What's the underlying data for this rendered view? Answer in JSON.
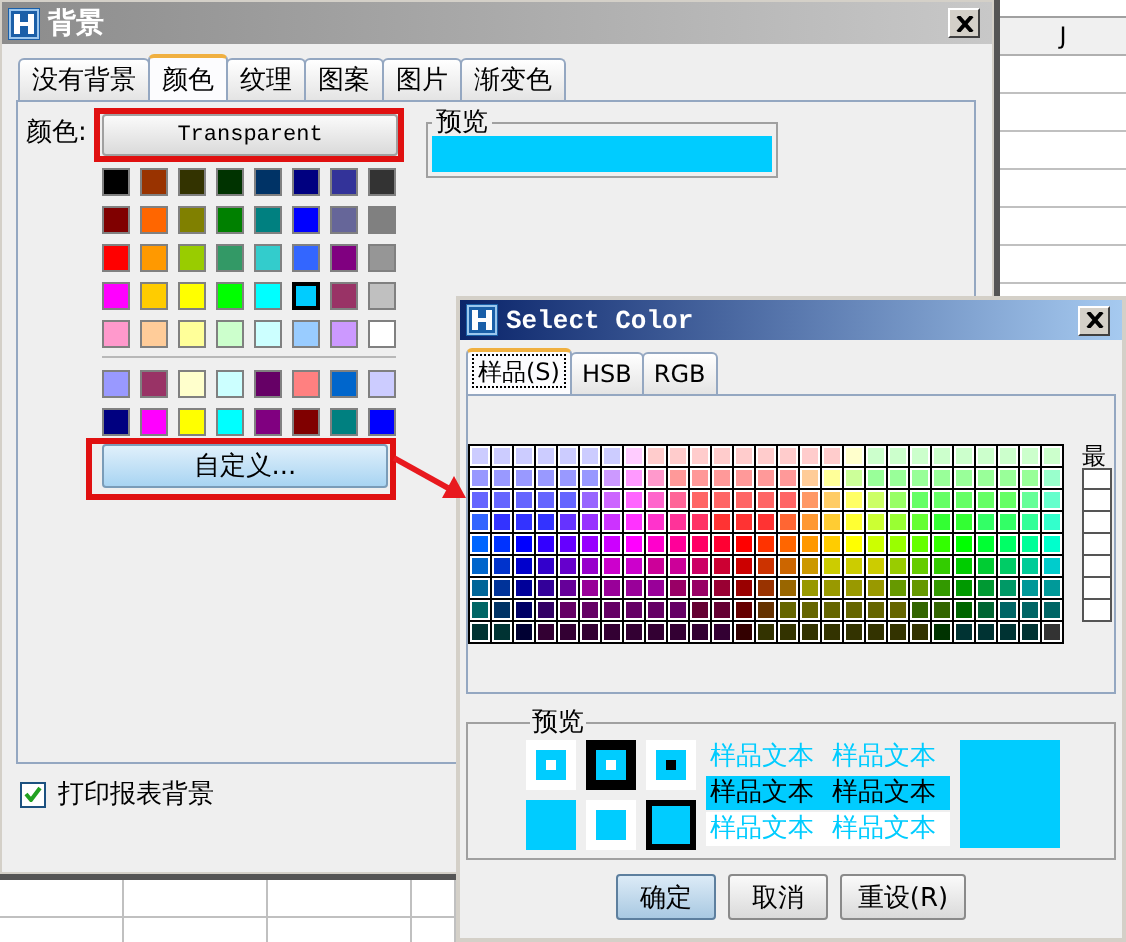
{
  "spreadsheet": {
    "column_header": "J"
  },
  "background_dialog": {
    "title": "背景",
    "tabs": [
      {
        "label": "没有背景",
        "selected": false
      },
      {
        "label": "颜色",
        "selected": true
      },
      {
        "label": "纹理",
        "selected": false
      },
      {
        "label": "图案",
        "selected": false
      },
      {
        "label": "图片",
        "selected": false
      },
      {
        "label": "渐变色",
        "selected": false
      }
    ],
    "color_label": "颜色:",
    "transparent_button": "Transparent",
    "preview_label": "预览",
    "standard_swatches": [
      {
        "swatches": [
          {
            "color": "#000000",
            "selected": false
          },
          {
            "color": "#993300",
            "selected": false
          },
          {
            "color": "#333300",
            "selected": false
          },
          {
            "color": "#003300",
            "selected": false
          },
          {
            "color": "#003366",
            "selected": false
          },
          {
            "color": "#000080",
            "selected": false
          },
          {
            "color": "#333399",
            "selected": false
          },
          {
            "color": "#333333",
            "selected": false
          }
        ]
      },
      {
        "swatches": [
          {
            "color": "#800000",
            "selected": false
          },
          {
            "color": "#ff6600",
            "selected": false
          },
          {
            "color": "#808000",
            "selected": false
          },
          {
            "color": "#008000",
            "selected": false
          },
          {
            "color": "#008080",
            "selected": false
          },
          {
            "color": "#0000ff",
            "selected": false
          },
          {
            "color": "#666699",
            "selected": false
          },
          {
            "color": "#808080",
            "selected": false
          }
        ]
      },
      {
        "swatches": [
          {
            "color": "#ff0000",
            "selected": false
          },
          {
            "color": "#ff9900",
            "selected": false
          },
          {
            "color": "#99cc00",
            "selected": false
          },
          {
            "color": "#339966",
            "selected": false
          },
          {
            "color": "#33cccc",
            "selected": false
          },
          {
            "color": "#3366ff",
            "selected": false
          },
          {
            "color": "#800080",
            "selected": false
          },
          {
            "color": "#969696",
            "selected": false
          }
        ]
      },
      {
        "swatches": [
          {
            "color": "#ff00ff",
            "selected": false
          },
          {
            "color": "#ffcc00",
            "selected": false
          },
          {
            "color": "#ffff00",
            "selected": false
          },
          {
            "color": "#00ff00",
            "selected": false
          },
          {
            "color": "#00ffff",
            "selected": false
          },
          {
            "color": "#00ccff",
            "selected": true
          },
          {
            "color": "#993366",
            "selected": false
          },
          {
            "color": "#c0c0c0",
            "selected": false
          }
        ]
      },
      {
        "swatches": [
          {
            "color": "#ff99cc",
            "selected": false
          },
          {
            "color": "#ffcc99",
            "selected": false
          },
          {
            "color": "#ffff99",
            "selected": false
          },
          {
            "color": "#ccffcc",
            "selected": false
          },
          {
            "color": "#ccffff",
            "selected": false
          },
          {
            "color": "#99ccff",
            "selected": false
          },
          {
            "color": "#cc99ff",
            "selected": false
          },
          {
            "color": "#ffffff",
            "selected": false
          }
        ]
      }
    ],
    "extra_swatches": [
      {
        "swatches": [
          {
            "color": "#9999ff",
            "selected": false
          },
          {
            "color": "#993366",
            "selected": false
          },
          {
            "color": "#ffffcc",
            "selected": false
          },
          {
            "color": "#ccffff",
            "selected": false
          },
          {
            "color": "#660066",
            "selected": false
          },
          {
            "color": "#ff8080",
            "selected": false
          },
          {
            "color": "#0066cc",
            "selected": false
          },
          {
            "color": "#ccccff",
            "selected": false
          }
        ]
      },
      {
        "swatches": [
          {
            "color": "#000080",
            "selected": false
          },
          {
            "color": "#ff00ff",
            "selected": false
          },
          {
            "color": "#ffff00",
            "selected": false
          },
          {
            "color": "#00ffff",
            "selected": false
          },
          {
            "color": "#800080",
            "selected": false
          },
          {
            "color": "#800000",
            "selected": false
          },
          {
            "color": "#008080",
            "selected": false
          },
          {
            "color": "#0000ff",
            "selected": false
          }
        ]
      }
    ],
    "custom_button": "自定义...",
    "print_background": {
      "label": "打印报表背景",
      "checked": true
    }
  },
  "select_color_dialog": {
    "title": "Select Color",
    "tabs": [
      {
        "label": "样品(S)",
        "selected": true
      },
      {
        "label": "HSB",
        "selected": false
      },
      {
        "label": "RGB",
        "selected": false
      }
    ],
    "palette": [
      {
        "cells": [
          {
            "color": "#ccccff"
          },
          {
            "color": "#ccccff"
          },
          {
            "color": "#ccccff"
          },
          {
            "color": "#ccccff"
          },
          {
            "color": "#ccccff"
          },
          {
            "color": "#ccccff"
          },
          {
            "color": "#ccccff"
          },
          {
            "color": "#ffccff"
          },
          {
            "color": "#ffcccc"
          },
          {
            "color": "#ffcccc"
          },
          {
            "color": "#ffcccc"
          },
          {
            "color": "#ffcccc"
          },
          {
            "color": "#ffcccc"
          },
          {
            "color": "#ffcccc"
          },
          {
            "color": "#ffcccc"
          },
          {
            "color": "#ffcccc"
          },
          {
            "color": "#ffcccc"
          },
          {
            "color": "#ffffcc"
          },
          {
            "color": "#ccffcc"
          },
          {
            "color": "#ccffcc"
          },
          {
            "color": "#ccffcc"
          },
          {
            "color": "#ccffcc"
          },
          {
            "color": "#ccffcc"
          },
          {
            "color": "#ccffcc"
          },
          {
            "color": "#ccffcc"
          },
          {
            "color": "#ccffcc"
          },
          {
            "color": "#ccffcc"
          }
        ]
      },
      {
        "cells": [
          {
            "color": "#9999ff"
          },
          {
            "color": "#9999ff"
          },
          {
            "color": "#9999ff"
          },
          {
            "color": "#9999ff"
          },
          {
            "color": "#9999ff"
          },
          {
            "color": "#9999ff"
          },
          {
            "color": "#cc99ff"
          },
          {
            "color": "#ff99ff"
          },
          {
            "color": "#ff99cc"
          },
          {
            "color": "#ff9999"
          },
          {
            "color": "#ff9999"
          },
          {
            "color": "#ff9999"
          },
          {
            "color": "#ff9999"
          },
          {
            "color": "#ff9999"
          },
          {
            "color": "#ff9999"
          },
          {
            "color": "#ffcc99"
          },
          {
            "color": "#ffff99"
          },
          {
            "color": "#ccff99"
          },
          {
            "color": "#99ff99"
          },
          {
            "color": "#99ff99"
          },
          {
            "color": "#99ff99"
          },
          {
            "color": "#99ff99"
          },
          {
            "color": "#99ff99"
          },
          {
            "color": "#99ff99"
          },
          {
            "color": "#99ff99"
          },
          {
            "color": "#99ff99"
          },
          {
            "color": "#99ffcc"
          }
        ]
      },
      {
        "cells": [
          {
            "color": "#6666ff"
          },
          {
            "color": "#6666ff"
          },
          {
            "color": "#6666ff"
          },
          {
            "color": "#6666ff"
          },
          {
            "color": "#6666ff"
          },
          {
            "color": "#9966ff"
          },
          {
            "color": "#cc66ff"
          },
          {
            "color": "#ff66ff"
          },
          {
            "color": "#ff66cc"
          },
          {
            "color": "#ff6699"
          },
          {
            "color": "#ff6666"
          },
          {
            "color": "#ff6666"
          },
          {
            "color": "#ff6666"
          },
          {
            "color": "#ff6666"
          },
          {
            "color": "#ff6666"
          },
          {
            "color": "#ff9966"
          },
          {
            "color": "#ffcc66"
          },
          {
            "color": "#ffff66"
          },
          {
            "color": "#ccff66"
          },
          {
            "color": "#99ff66"
          },
          {
            "color": "#66ff66"
          },
          {
            "color": "#66ff66"
          },
          {
            "color": "#66ff66"
          },
          {
            "color": "#66ff66"
          },
          {
            "color": "#66ff66"
          },
          {
            "color": "#66ff99"
          },
          {
            "color": "#66ffcc"
          }
        ]
      },
      {
        "cells": [
          {
            "color": "#3366ff"
          },
          {
            "color": "#3333ff"
          },
          {
            "color": "#3333ff"
          },
          {
            "color": "#3333ff"
          },
          {
            "color": "#6633ff"
          },
          {
            "color": "#9933ff"
          },
          {
            "color": "#cc33ff"
          },
          {
            "color": "#ff33ff"
          },
          {
            "color": "#ff33cc"
          },
          {
            "color": "#ff3399"
          },
          {
            "color": "#ff3366"
          },
          {
            "color": "#ff3333"
          },
          {
            "color": "#ff3333"
          },
          {
            "color": "#ff3333"
          },
          {
            "color": "#ff6633"
          },
          {
            "color": "#ff9933"
          },
          {
            "color": "#ffcc33"
          },
          {
            "color": "#ffff33"
          },
          {
            "color": "#ccff33"
          },
          {
            "color": "#99ff33"
          },
          {
            "color": "#66ff33"
          },
          {
            "color": "#33ff33"
          },
          {
            "color": "#33ff33"
          },
          {
            "color": "#33ff66"
          },
          {
            "color": "#33ff66"
          },
          {
            "color": "#33ff99"
          },
          {
            "color": "#33ffcc"
          }
        ]
      },
      {
        "cells": [
          {
            "color": "#0066ff"
          },
          {
            "color": "#0033ff"
          },
          {
            "color": "#0000ff"
          },
          {
            "color": "#3300ff"
          },
          {
            "color": "#6600ff"
          },
          {
            "color": "#9900ff"
          },
          {
            "color": "#cc00ff"
          },
          {
            "color": "#ff00ff"
          },
          {
            "color": "#ff00cc"
          },
          {
            "color": "#ff0099"
          },
          {
            "color": "#ff0066"
          },
          {
            "color": "#ff0033"
          },
          {
            "color": "#ff0000"
          },
          {
            "color": "#ff3300"
          },
          {
            "color": "#ff6600"
          },
          {
            "color": "#ff9900"
          },
          {
            "color": "#ffcc00"
          },
          {
            "color": "#ffff00"
          },
          {
            "color": "#ccff00"
          },
          {
            "color": "#99ff00"
          },
          {
            "color": "#66ff00"
          },
          {
            "color": "#33ff00"
          },
          {
            "color": "#00ff00"
          },
          {
            "color": "#00ff33"
          },
          {
            "color": "#00ff66"
          },
          {
            "color": "#00ff99"
          },
          {
            "color": "#00ffcc"
          }
        ]
      },
      {
        "cells": [
          {
            "color": "#0066cc"
          },
          {
            "color": "#0033cc"
          },
          {
            "color": "#0000cc"
          },
          {
            "color": "#3300cc"
          },
          {
            "color": "#6600cc"
          },
          {
            "color": "#9900cc"
          },
          {
            "color": "#cc00cc"
          },
          {
            "color": "#cc00cc"
          },
          {
            "color": "#cc0099"
          },
          {
            "color": "#cc0099"
          },
          {
            "color": "#cc0066"
          },
          {
            "color": "#cc0033"
          },
          {
            "color": "#cc0000"
          },
          {
            "color": "#cc3300"
          },
          {
            "color": "#cc6600"
          },
          {
            "color": "#cc9900"
          },
          {
            "color": "#cccc00"
          },
          {
            "color": "#cccc00"
          },
          {
            "color": "#cccc00"
          },
          {
            "color": "#99cc00"
          },
          {
            "color": "#66cc00"
          },
          {
            "color": "#33cc00"
          },
          {
            "color": "#00cc00"
          },
          {
            "color": "#00cc33"
          },
          {
            "color": "#00cc66"
          },
          {
            "color": "#00cc99"
          },
          {
            "color": "#00cccc"
          }
        ]
      },
      {
        "cells": [
          {
            "color": "#006699"
          },
          {
            "color": "#003399"
          },
          {
            "color": "#000099"
          },
          {
            "color": "#330099"
          },
          {
            "color": "#660099"
          },
          {
            "color": "#990099"
          },
          {
            "color": "#990099"
          },
          {
            "color": "#990099"
          },
          {
            "color": "#990099"
          },
          {
            "color": "#990066"
          },
          {
            "color": "#990066"
          },
          {
            "color": "#990033"
          },
          {
            "color": "#990000"
          },
          {
            "color": "#993300"
          },
          {
            "color": "#996600"
          },
          {
            "color": "#999900"
          },
          {
            "color": "#999900"
          },
          {
            "color": "#999900"
          },
          {
            "color": "#999900"
          },
          {
            "color": "#669900"
          },
          {
            "color": "#669900"
          },
          {
            "color": "#339900"
          },
          {
            "color": "#009900"
          },
          {
            "color": "#009933"
          },
          {
            "color": "#009966"
          },
          {
            "color": "#009999"
          },
          {
            "color": "#009999"
          }
        ]
      },
      {
        "cells": [
          {
            "color": "#006666"
          },
          {
            "color": "#003366"
          },
          {
            "color": "#000066"
          },
          {
            "color": "#330066"
          },
          {
            "color": "#660066"
          },
          {
            "color": "#660066"
          },
          {
            "color": "#660066"
          },
          {
            "color": "#660066"
          },
          {
            "color": "#660066"
          },
          {
            "color": "#660066"
          },
          {
            "color": "#660033"
          },
          {
            "color": "#660033"
          },
          {
            "color": "#660000"
          },
          {
            "color": "#663300"
          },
          {
            "color": "#666600"
          },
          {
            "color": "#666600"
          },
          {
            "color": "#666600"
          },
          {
            "color": "#666600"
          },
          {
            "color": "#666600"
          },
          {
            "color": "#666600"
          },
          {
            "color": "#336600"
          },
          {
            "color": "#336600"
          },
          {
            "color": "#006600"
          },
          {
            "color": "#006633"
          },
          {
            "color": "#006666"
          },
          {
            "color": "#006666"
          },
          {
            "color": "#006666"
          }
        ]
      },
      {
        "cells": [
          {
            "color": "#003333"
          },
          {
            "color": "#003333"
          },
          {
            "color": "#000033"
          },
          {
            "color": "#330033"
          },
          {
            "color": "#330033"
          },
          {
            "color": "#330033"
          },
          {
            "color": "#330033"
          },
          {
            "color": "#330033"
          },
          {
            "color": "#330033"
          },
          {
            "color": "#330033"
          },
          {
            "color": "#330033"
          },
          {
            "color": "#330033"
          },
          {
            "color": "#330000"
          },
          {
            "color": "#333300"
          },
          {
            "color": "#333300"
          },
          {
            "color": "#333300"
          },
          {
            "color": "#333300"
          },
          {
            "color": "#333300"
          },
          {
            "color": "#333300"
          },
          {
            "color": "#333300"
          },
          {
            "color": "#333300"
          },
          {
            "color": "#003300"
          },
          {
            "color": "#003333"
          },
          {
            "color": "#003333"
          },
          {
            "color": "#003333"
          },
          {
            "color": "#003333"
          },
          {
            "color": "#333333"
          }
        ]
      }
    ],
    "recent_label": "最",
    "preview_label": "预览",
    "sample_rows": [
      {
        "kind": "plain",
        "texts": [
          "样品文本",
          "样品文本"
        ]
      },
      {
        "kind": "highlighted",
        "texts": [
          "样品文本",
          "样品文本"
        ]
      },
      {
        "kind": "on-white",
        "texts": [
          "样品文本",
          "样品文本"
        ]
      }
    ],
    "buttons": [
      {
        "label": "确定",
        "default": true
      },
      {
        "label": "取消",
        "default": false
      },
      {
        "label": "重设(R)",
        "default": false
      }
    ]
  }
}
